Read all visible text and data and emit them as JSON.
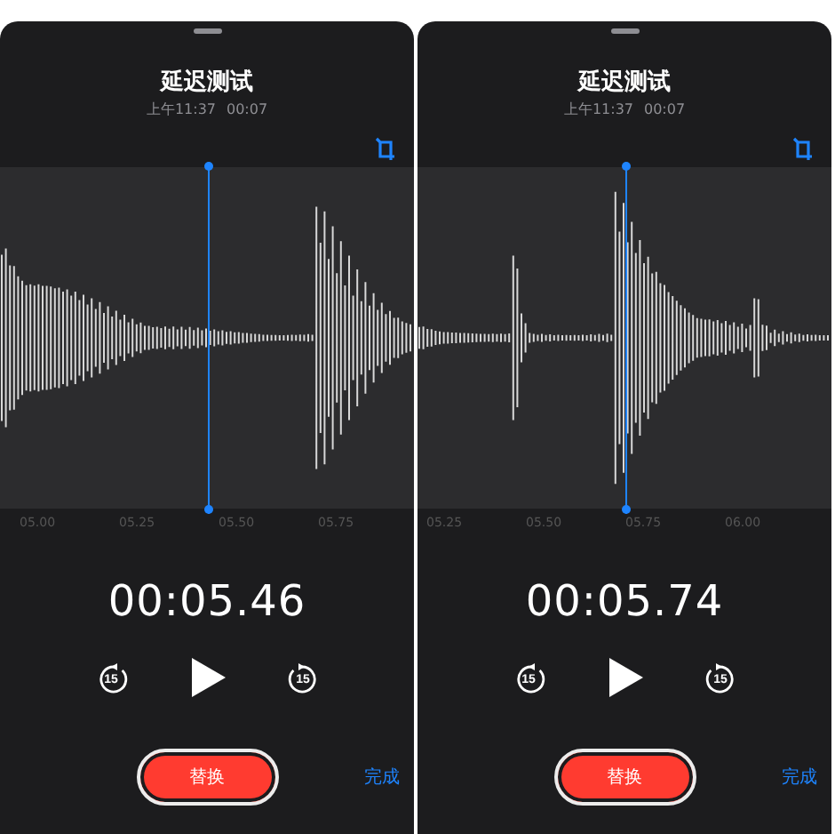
{
  "panels": [
    {
      "title": "延迟测试",
      "recorded_at": "上午11:37",
      "duration": "00:07",
      "ticks": [
        "05.00",
        "05.25",
        "05.50",
        "05.75"
      ],
      "time": "00:05.46",
      "skip_back": "15",
      "skip_forward": "15",
      "replace_button": "替换",
      "done_button": "完成"
    },
    {
      "title": "延迟测试",
      "recorded_at": "上午11:37",
      "duration": "00:07",
      "ticks": [
        "05.25",
        "05.50",
        "05.75",
        "06.00"
      ],
      "time": "00:05.74",
      "skip_back": "15",
      "skip_forward": "15",
      "replace_button": "替换",
      "done_button": "完成"
    }
  ]
}
